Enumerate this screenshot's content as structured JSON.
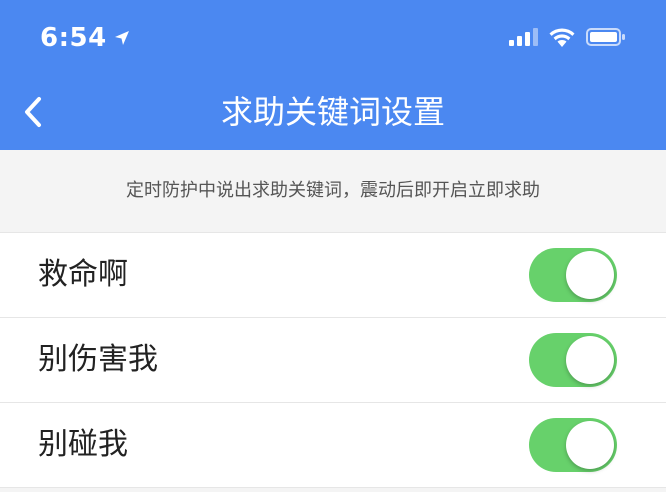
{
  "status_bar": {
    "time": "6:54",
    "icons": [
      "location-arrow-icon",
      "cellular-signal-icon",
      "wifi-icon",
      "battery-icon"
    ]
  },
  "nav": {
    "back_icon": "chevron-left-icon",
    "title": "求助关键词设置"
  },
  "hint": "定时防护中说出求助关键词，震动后即开启立即求助",
  "keywords": [
    {
      "label": "救命啊",
      "enabled": true
    },
    {
      "label": "别伤害我",
      "enabled": true
    },
    {
      "label": "别碰我",
      "enabled": true
    }
  ],
  "colors": {
    "header_bg": "#4b88f1",
    "toggle_on": "#67d16b",
    "page_bg": "#f4f4f4"
  }
}
